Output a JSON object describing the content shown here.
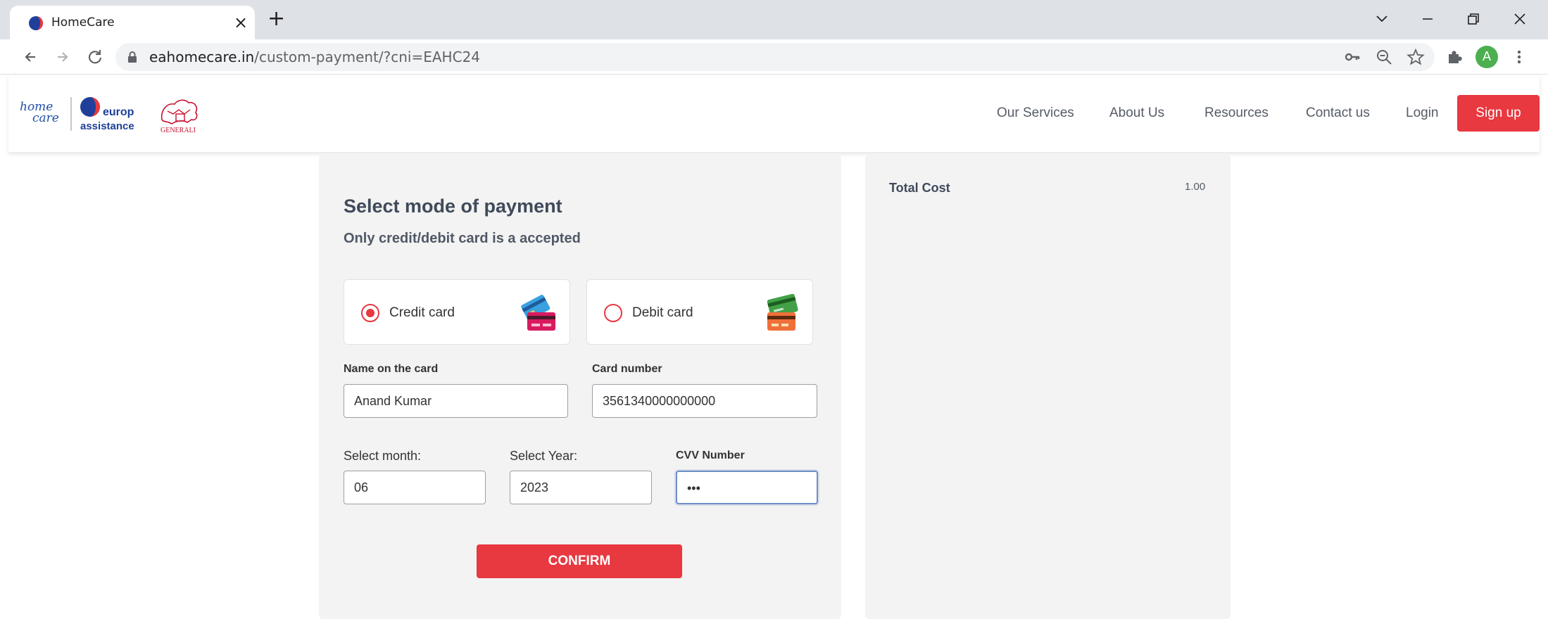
{
  "browser": {
    "tab_title": "HomeCare",
    "new_tab_label": "+",
    "close_tab_label": "×",
    "url_host": "eahomecare.in",
    "url_path": "/custom-payment/?cni=EAHC24",
    "profile_initial": "A"
  },
  "header": {
    "logo_home_line1": "home",
    "logo_home_line2": "care",
    "logo_europ_line1": "europ",
    "logo_europ_line2": "assistance",
    "logo_generali": "GENERALI",
    "nav": [
      "Our Services",
      "About Us",
      "Resources",
      "Contact us",
      "Login"
    ],
    "signup_label": "Sign up"
  },
  "payment": {
    "title": "Select mode of payment",
    "subtitle": "Only credit/debit card is a accepted",
    "options": [
      {
        "label": "Credit card",
        "selected": true
      },
      {
        "label": "Debit card",
        "selected": false
      }
    ],
    "name_label": "Name on the card",
    "name_value": "Anand Kumar",
    "card_label": "Card number",
    "card_value": "3561340000000000",
    "month_label": "Select month:",
    "month_value": "06",
    "year_label": "Select Year:",
    "year_value": "2023",
    "cvv_label": "CVV Number",
    "cvv_value": "•••",
    "confirm_label": "CONFIRM"
  },
  "summary": {
    "total_label": "Total Cost",
    "total_value": "1.00"
  },
  "colors": {
    "accent": "#e83840",
    "panel": "#f3f3f3",
    "chrome": "#dee1e6"
  }
}
